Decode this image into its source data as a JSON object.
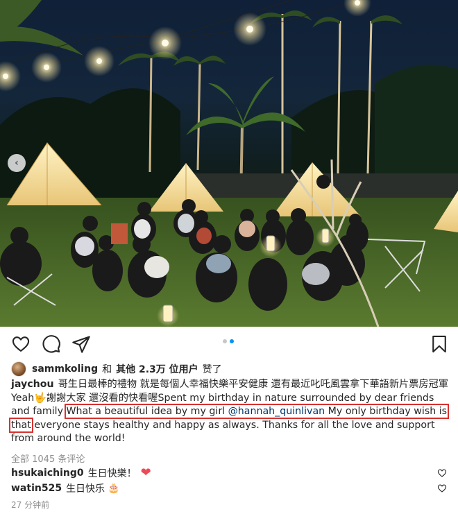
{
  "post": {
    "liked_by_user": "sammkoling",
    "likes_text_and": "和",
    "likes_text_others": "其他 2.3万 位用户",
    "likes_text_liked": "赞了",
    "caption_user": "jaychou",
    "caption_part1": "哥生日最棒的禮物 就是每個人幸福快樂平安健康 還有最近叱吒風雲拿下華語新片票房冠軍 Yeah",
    "caption_emoji": "🤟",
    "caption_part2": "謝謝大家 還沒看的快看喔Spent my birthday in nature surrounded by dear friends and family ",
    "caption_highlight_pre": "What a beautiful idea by my girl ",
    "caption_mention": "@hannah_quinlivan",
    "caption_highlight_post": " My only birthday wish is that",
    "caption_part3": " everyone stays healthy and happy as always. Thanks for all the love and support from around the world!",
    "view_comments": "全部 1045 条评论",
    "comments": [
      {
        "user": "hsukaiching0",
        "text": "生日快樂！",
        "emoji": "❤"
      },
      {
        "user": "watin525",
        "text": "生日快乐",
        "emoji": "🎂"
      }
    ],
    "timestamp": "27 分钟前"
  },
  "carousel": {
    "current": 2,
    "total": 2
  },
  "icons": {
    "like": "heart-outline-icon",
    "comment": "comment-bubble-icon",
    "share": "paper-plane-icon",
    "save": "bookmark-icon",
    "prev": "chevron-left-icon"
  },
  "colors": {
    "accent_dot": "#0095f6",
    "mention": "#00376b",
    "highlight_box": "#d6322f",
    "heart_red": "#ed4956"
  }
}
